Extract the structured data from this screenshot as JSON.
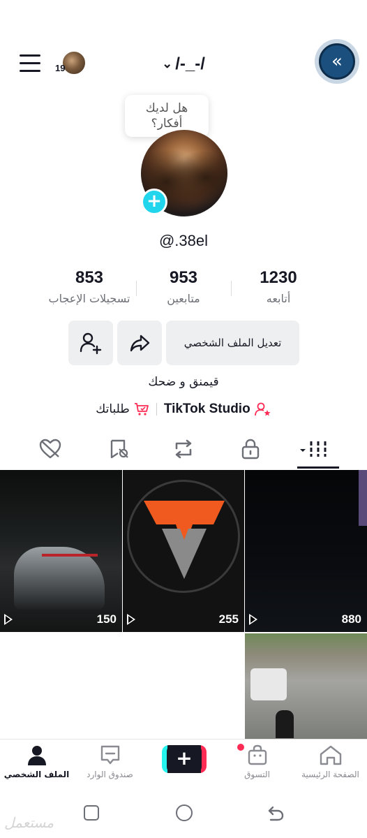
{
  "header": {
    "username": "/-_-/",
    "friends_count": "19"
  },
  "profile": {
    "bubble_text_line1": "هل لديك",
    "bubble_text_line2": "أفكار؟",
    "handle": "@.38el",
    "stats": [
      {
        "value": "853",
        "label": "تسجيلات الإعجاب"
      },
      {
        "value": "953",
        "label": "متابعين"
      },
      {
        "value": "1230",
        "label": "أتابعه"
      }
    ],
    "edit_button_label": "تعديل الملف الشخصي",
    "bio": "قيمنق و ضحك",
    "studio_label": "TikTok Studio",
    "orders_label": "طلباتك"
  },
  "tabs": [
    "liked-hidden-tab",
    "favorites-tab",
    "reposts-tab",
    "private-tab",
    "videos-tab"
  ],
  "videos": [
    {
      "views": "150"
    },
    {
      "views": "255"
    },
    {
      "views": "880"
    }
  ],
  "bottom_nav": {
    "profile": "الملف الشخصي",
    "inbox": "صندوق الوارد",
    "shop": "التسوق",
    "home": "الصفحة الرئيسية"
  },
  "watermark": "مستعمل",
  "colors": {
    "accent_cyan": "#20d5ec",
    "tiktok_red": "#fe2c55",
    "tiktok_cyan": "#25f4ee",
    "text_primary": "#161823",
    "text_secondary": "#6d6f76"
  }
}
